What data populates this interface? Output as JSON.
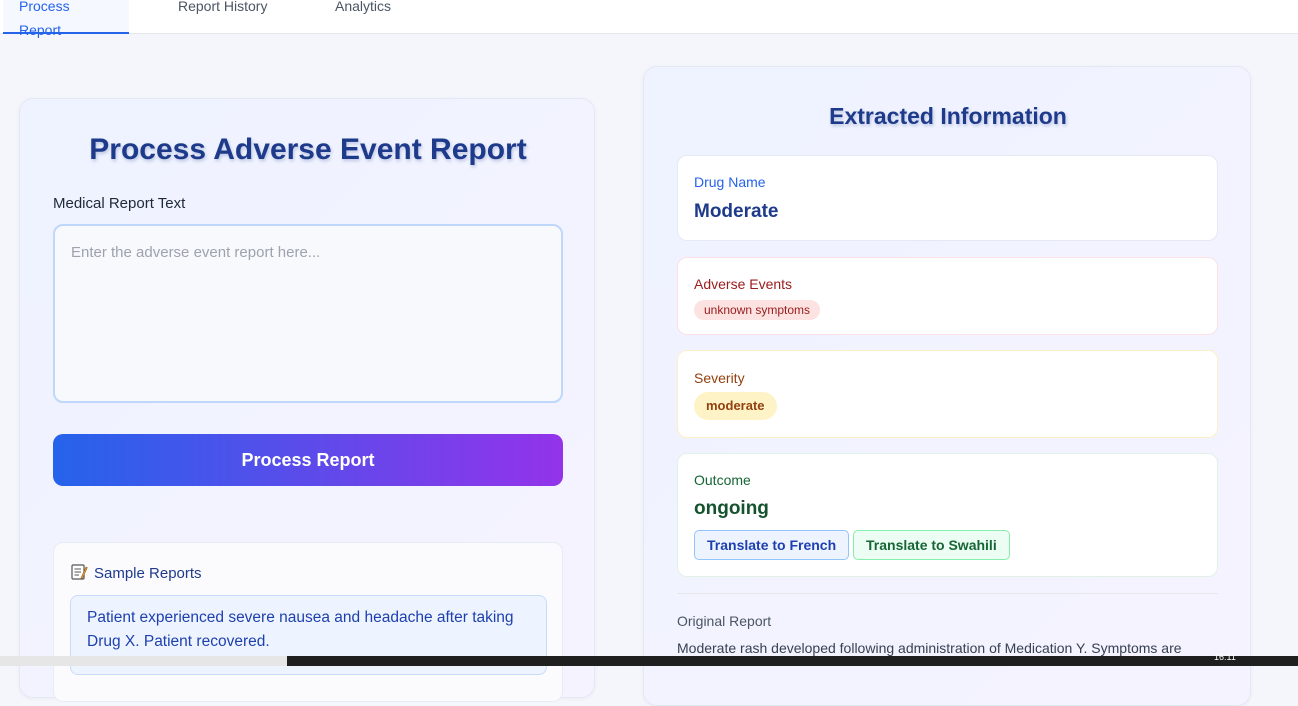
{
  "tabs": [
    {
      "label": "Process Report",
      "active": true
    },
    {
      "label": "Report History",
      "active": false
    },
    {
      "label": "Analytics",
      "active": false
    }
  ],
  "form": {
    "title": "Process Adverse Event Report",
    "field_label": "Medical Report Text",
    "placeholder": "Enter the adverse event report here...",
    "value": "",
    "submit_label": "Process Report"
  },
  "samples": {
    "heading": "Sample Reports",
    "items": [
      "Patient experienced severe nausea and headache after taking Drug X. Patient recovered."
    ]
  },
  "extracted": {
    "title": "Extracted Information",
    "drug": {
      "label": "Drug Name",
      "value": "Moderate"
    },
    "adverse": {
      "label": "Adverse Events",
      "tags": [
        "unknown symptoms"
      ]
    },
    "severity": {
      "label": "Severity",
      "value": "moderate"
    },
    "outcome": {
      "label": "Outcome",
      "value": "ongoing"
    },
    "translate_french": "Translate to French",
    "translate_swahili": "Translate to Swahili",
    "original_label": "Original Report",
    "original_text": "Moderate rash developed following administration of Medication Y. Symptoms are"
  },
  "taskbar": {
    "clock": "16:11"
  },
  "colors": {
    "accent": "#2563eb",
    "accent_end": "#9333ea",
    "title": "#1e3a8a",
    "adverse": "#991b1b",
    "severity": "#92400e",
    "outcome": "#166534"
  }
}
